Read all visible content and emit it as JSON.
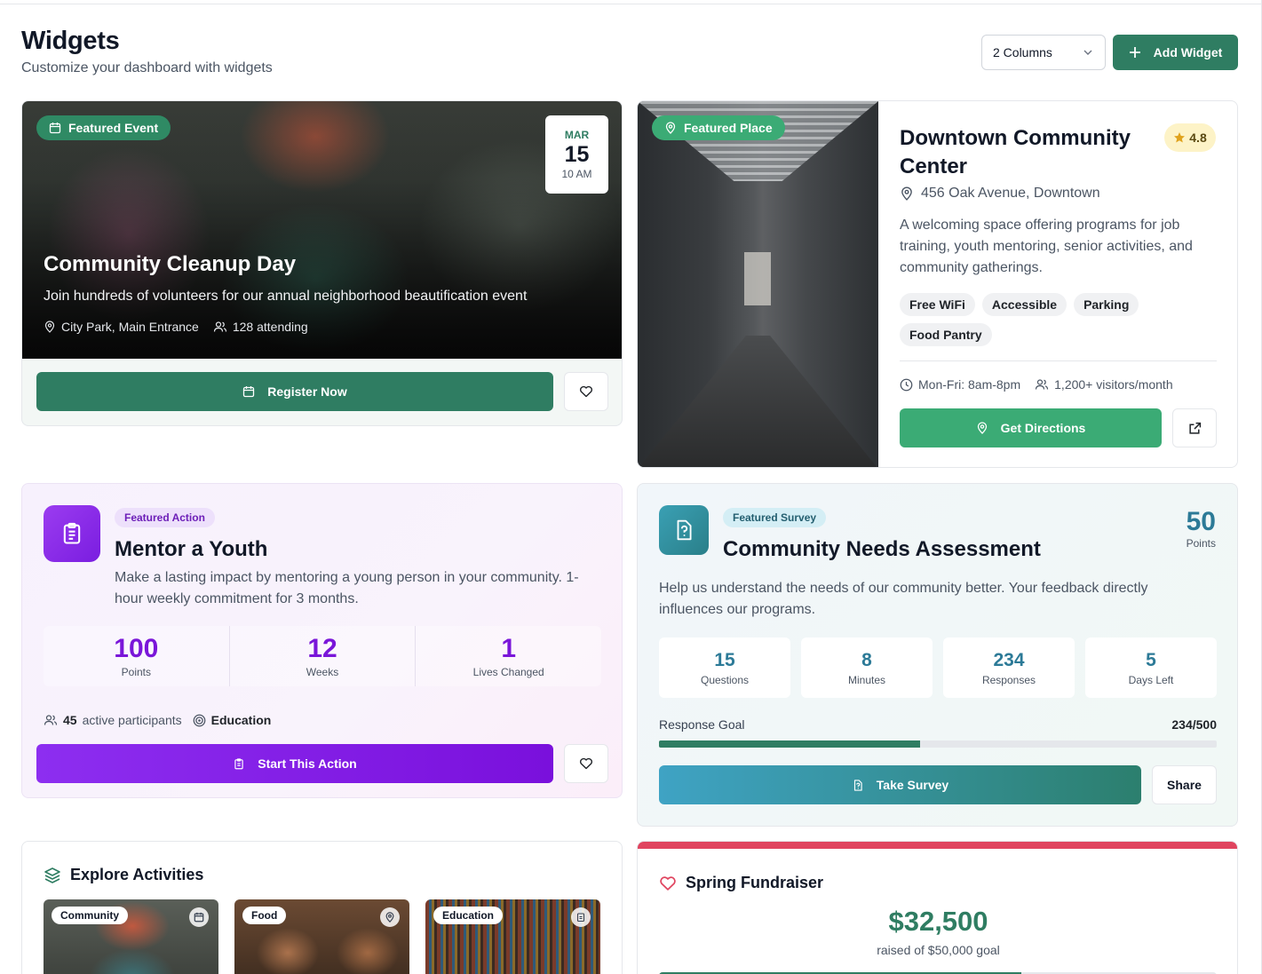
{
  "header": {
    "title": "Widgets",
    "subtitle": "Customize your dashboard with widgets",
    "columns_select": "2 Columns",
    "add_widget": "Add Widget"
  },
  "event": {
    "badge": "Featured Event",
    "month": "MAR",
    "day": "15",
    "time": "10 AM",
    "title": "Community Cleanup Day",
    "description": "Join hundreds of volunteers for our annual neighborhood beautification event",
    "location": "City Park, Main Entrance",
    "attending": "128 attending",
    "register": "Register Now"
  },
  "place": {
    "badge": "Featured Place",
    "title": "Downtown Community Center",
    "rating": "4.8",
    "address": "456 Oak Avenue, Downtown",
    "description": "A welcoming space offering programs for job training, youth mentoring, senior activities, and community gatherings.",
    "tags": [
      "Free WiFi",
      "Accessible",
      "Parking",
      "Food Pantry"
    ],
    "hours": "Mon-Fri: 8am-8pm",
    "visitors": "1,200+ visitors/month",
    "directions": "Get Directions"
  },
  "action": {
    "badge": "Featured Action",
    "title": "Mentor a Youth",
    "description": "Make a lasting impact by mentoring a young person in your community. 1-hour weekly commitment for 3 months.",
    "stats": [
      {
        "value": "100",
        "label": "Points"
      },
      {
        "value": "12",
        "label": "Weeks"
      },
      {
        "value": "1",
        "label": "Lives Changed"
      }
    ],
    "participants_count": "45",
    "participants_text": "active participants",
    "category": "Education",
    "start": "Start This Action"
  },
  "survey": {
    "badge": "Featured Survey",
    "title": "Community Needs Assessment",
    "points_value": "50",
    "points_label": "Points",
    "description": "Help us understand the needs of our community better. Your feedback directly influences our programs.",
    "stats": [
      {
        "value": "15",
        "label": "Questions"
      },
      {
        "value": "8",
        "label": "Minutes"
      },
      {
        "value": "234",
        "label": "Responses"
      },
      {
        "value": "5",
        "label": "Days Left"
      }
    ],
    "goal_label": "Response Goal",
    "goal_value": "234/500",
    "progress_fraction": 0.468,
    "take": "Take Survey",
    "share": "Share"
  },
  "explore": {
    "title": "Explore Activities",
    "tiles": [
      {
        "label": "Community",
        "icon": "calendar-icon"
      },
      {
        "label": "Food",
        "icon": "map-pin-icon"
      },
      {
        "label": "Education",
        "icon": "clipboard-icon"
      }
    ]
  },
  "fundraiser": {
    "title": "Spring Fundraiser",
    "amount": "$32,500",
    "goal_text": "raised of $50,000 goal",
    "progress_fraction": 0.65
  },
  "colors": {
    "primary_green": "#2f7d62",
    "place_green": "#3bab75",
    "purple": "#7a16d9",
    "teal": "#2c7a97",
    "fundraiser_red": "#e0445f"
  }
}
